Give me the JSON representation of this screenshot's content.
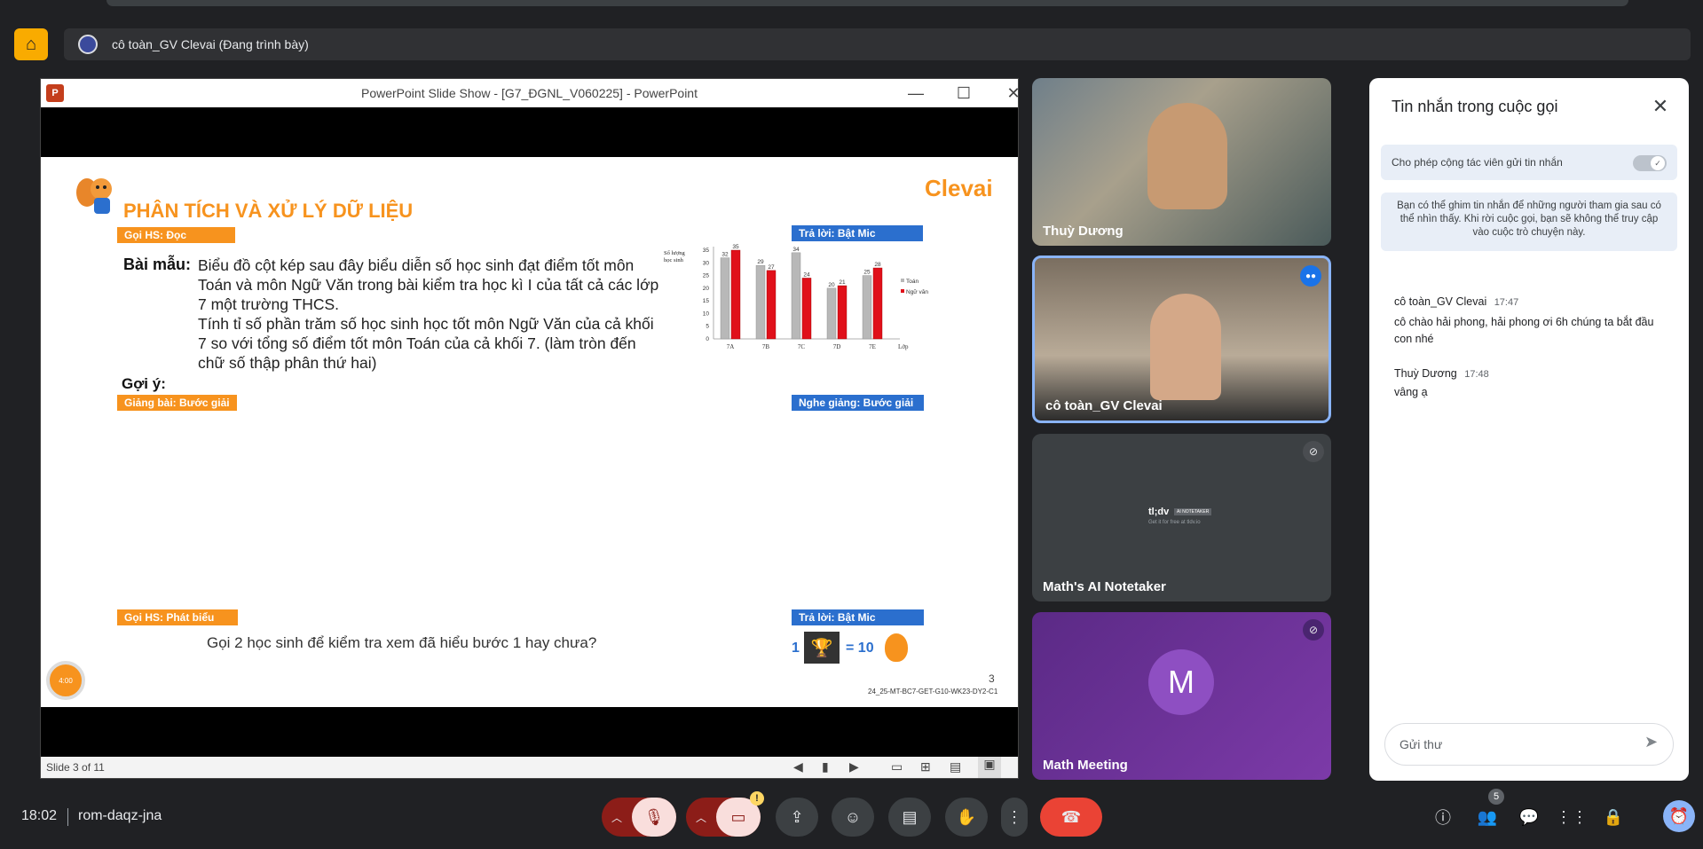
{
  "presenter_bar": {
    "text": "cô toàn_GV Clevai (Đang trình bày)"
  },
  "ppt": {
    "window_title": "PowerPoint Slide Show - [G7_ĐGNL_V060225] - PowerPoint",
    "status": "Slide 3 of 11"
  },
  "slide": {
    "title": "PHÂN TÍCH VÀ XỬ LÝ DỮ LIỆU",
    "logo": "Clevai",
    "tag_goi_doc": "Gọi HS: Đọc",
    "tag_tra_loi_1": "Trả lời: Bật Mic",
    "baimau_label": "Bài mẫu:",
    "baimau_text_1": "Biểu đồ cột kép sau đây biểu diễn số học sinh đạt điểm tốt môn Toán và môn Ngữ Văn trong bài kiểm tra học kì I của tất cả các lớp 7 một trường THCS.",
    "baimau_text_2": "Tính tỉ số phần trăm số học sinh học tốt môn Ngữ Văn của cả khối 7 so với tổng số điểm tốt môn Toán của cả khối 7. (làm tròn đến chữ số thập phân thứ hai)",
    "goiy": "Gợi ý:",
    "tag_giang_bai": "Giảng bài: Bước giải",
    "tag_nghe_giang": "Nghe giảng: Bước giải",
    "tag_goi_phat_bieu": "Gọi HS: Phát biểu",
    "tag_tra_loi_2": "Trả lời: Bật Mic",
    "question": "Gọi 2 học sinh để kiểm tra xem đã hiểu bước 1 hay chưa?",
    "reward_left": "1",
    "reward_right": "= 10",
    "page_number": "3",
    "code": "24_25-MT-BC7-GET-G10-WK23-DY2-C1",
    "timer": "4:00"
  },
  "chart_data": {
    "type": "bar",
    "categories": [
      "7A",
      "7B",
      "7C",
      "7D",
      "7E"
    ],
    "series": [
      {
        "name": "Toán",
        "values": [
          32,
          29,
          34,
          20,
          25
        ],
        "color": "#b8b8b8"
      },
      {
        "name": "Ngữ văn",
        "values": [
          35,
          27,
          24,
          21,
          28
        ],
        "color": "#e0101a"
      }
    ],
    "ylabel": "Số lượng học sinh",
    "xlabel": "Lớp",
    "yticks": [
      0,
      5,
      10,
      15,
      20,
      25,
      30,
      35
    ],
    "ylim": [
      0,
      35
    ],
    "legend": "right"
  },
  "tiles": [
    {
      "name": "Thuỳ Dương"
    },
    {
      "name": "cô toàn_GV Clevai"
    },
    {
      "name": "Math's AI Notetaker",
      "logo_text": "tl;dv",
      "logo_badge": "AI NOTETAKER",
      "logo_sub": "Get it for free at tldv.io"
    },
    {
      "name": "Math Meeting",
      "avatar_letter": "M"
    }
  ],
  "chat": {
    "title": "Tin nhắn trong cuộc gọi",
    "toggle_label": "Cho phép cộng tác viên gửi tin nhắn",
    "info": "Bạn có thể ghim tin nhắn để những người tham gia sau có thể nhìn thấy. Khi rời cuộc gọi, bạn sẽ không thể truy cập vào cuộc trò chuyện này.",
    "messages": [
      {
        "author": "cô toàn_GV Clevai",
        "time": "17:47",
        "text": "cô chào hải phong, hải phong ơi 6h chúng ta bắt đầu con nhé"
      },
      {
        "author": "Thuỳ Dương",
        "time": "17:48",
        "text": "vâng ạ"
      }
    ],
    "input_placeholder": "Gửi thư"
  },
  "bottom": {
    "time": "18:02",
    "meeting_code": "rom-daqz-jna",
    "people_count": "5",
    "camera_badge": "!"
  }
}
